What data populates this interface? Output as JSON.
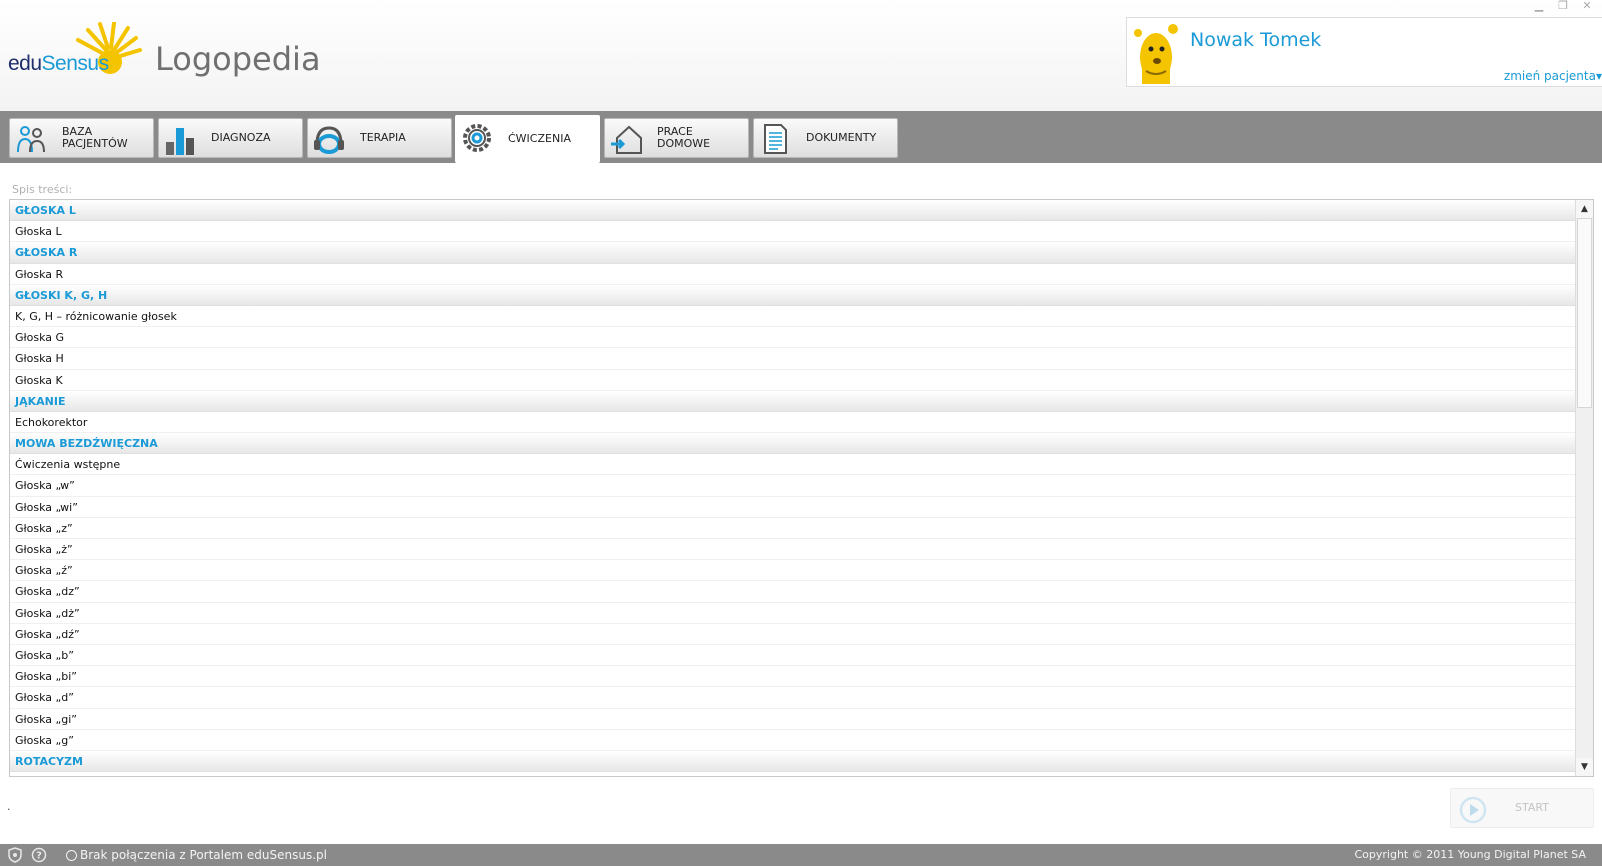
{
  "app": {
    "logo_edu": "edu",
    "logo_sensus": "Sensus",
    "title": "Logopedia"
  },
  "window_controls": {
    "minimize": "▁",
    "maximize": "❐",
    "close": "✕"
  },
  "patient": {
    "name": "Nowak Tomek",
    "change_label": "zmień pacjenta▾"
  },
  "nav": {
    "tabs": [
      {
        "label": "BAZA\nPACJENTÓW",
        "icon": "patients-icon",
        "active": false
      },
      {
        "label": "DIAGNOZA",
        "icon": "chart-icon",
        "active": false
      },
      {
        "label": "TERAPIA",
        "icon": "headphones-icon",
        "active": false
      },
      {
        "label": "ĆWICZENIA",
        "icon": "gear-icon",
        "active": true
      },
      {
        "label": "PRACE\nDOMOWE",
        "icon": "home-icon",
        "active": false
      },
      {
        "label": "DOKUMENTY",
        "icon": "document-icon",
        "active": false
      }
    ]
  },
  "content": {
    "toc_label": "Spis treści:",
    "items": [
      {
        "text": "GŁOSKA L",
        "type": "section"
      },
      {
        "text": "Głoska L",
        "type": "item"
      },
      {
        "text": "GŁOSKA R",
        "type": "section"
      },
      {
        "text": "Głoska R",
        "type": "item"
      },
      {
        "text": "GŁOSKI K, G, H",
        "type": "section"
      },
      {
        "text": "K, G, H – różnicowanie głosek",
        "type": "item"
      },
      {
        "text": "Głoska G",
        "type": "item"
      },
      {
        "text": "Głoska H",
        "type": "item"
      },
      {
        "text": "Głoska K",
        "type": "item"
      },
      {
        "text": "JĄKANIE",
        "type": "section"
      },
      {
        "text": "Echokorektor",
        "type": "item"
      },
      {
        "text": "MOWA BEZDŹWIĘCZNA",
        "type": "section"
      },
      {
        "text": "Ćwiczenia wstępne",
        "type": "item"
      },
      {
        "text": "Głoska „w”",
        "type": "item"
      },
      {
        "text": "Głoska „wi”",
        "type": "item"
      },
      {
        "text": "Głoska „z”",
        "type": "item"
      },
      {
        "text": "Głoska „ż”",
        "type": "item"
      },
      {
        "text": "Głoska „ź”",
        "type": "item"
      },
      {
        "text": "Głoska „dz”",
        "type": "item"
      },
      {
        "text": "Głoska „dż”",
        "type": "item"
      },
      {
        "text": "Głoska „dź”",
        "type": "item"
      },
      {
        "text": "Głoska „b”",
        "type": "item"
      },
      {
        "text": "Głoska „bi”",
        "type": "item"
      },
      {
        "text": "Głoska „d”",
        "type": "item"
      },
      {
        "text": "Głoska „gi”",
        "type": "item"
      },
      {
        "text": "Głoska „g”",
        "type": "item"
      },
      {
        "text": "ROTACYZM",
        "type": "section"
      }
    ],
    "dot": ".",
    "start_label": "START"
  },
  "scrollbar": {
    "up": "▲",
    "down": "▼"
  },
  "status": {
    "connection": "Brak połączenia z Portalem eduSensus.pl",
    "copyright": "Copyright © 2011 Young Digital Planet SA"
  },
  "colors": {
    "accent": "#1a9ad6",
    "navbar": "#8a8a8a",
    "logo_dark": "#1f2f6b",
    "sun": "#f5c400"
  }
}
